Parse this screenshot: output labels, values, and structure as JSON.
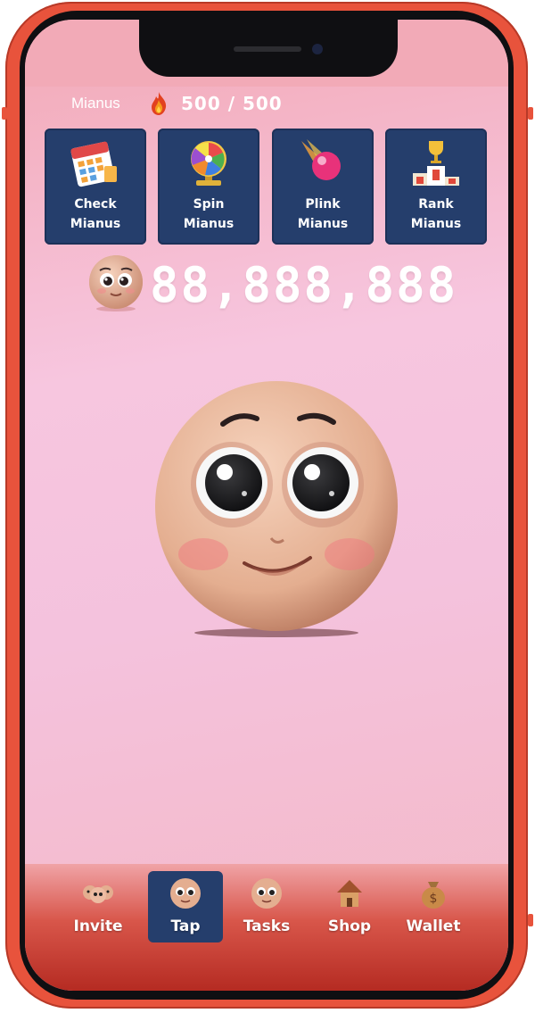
{
  "topbar": {
    "username": "Mianus",
    "energy_icon": "fire-icon",
    "energy": "500 / 500"
  },
  "tiles": [
    {
      "line1": "Check",
      "line2": "Mianus",
      "icon": "calendar-icon"
    },
    {
      "line1": "Spin",
      "line2": "Mianus",
      "icon": "wheel-icon"
    },
    {
      "line1": "Plink",
      "line2": "Mianus",
      "icon": "ball-icon"
    },
    {
      "line1": "Rank",
      "line2": "Mianus",
      "icon": "podium-icon"
    }
  ],
  "balance": {
    "icon": "coin-face-icon",
    "value": "88,888,888"
  },
  "nav": [
    {
      "label": "Invite",
      "icon": "faces-icon",
      "active": false
    },
    {
      "label": "Tap",
      "icon": "face-icon",
      "active": true
    },
    {
      "label": "Tasks",
      "icon": "face-icon",
      "active": false
    },
    {
      "label": "Shop",
      "icon": "house-icon",
      "active": false
    },
    {
      "label": "Wallet",
      "icon": "money-bag-icon",
      "active": false
    }
  ],
  "colors": {
    "frame": "#e8533c",
    "tile_bg": "#253e6c",
    "screen_bg": "#f7c6df",
    "nav_bottom": "#b52b22"
  }
}
